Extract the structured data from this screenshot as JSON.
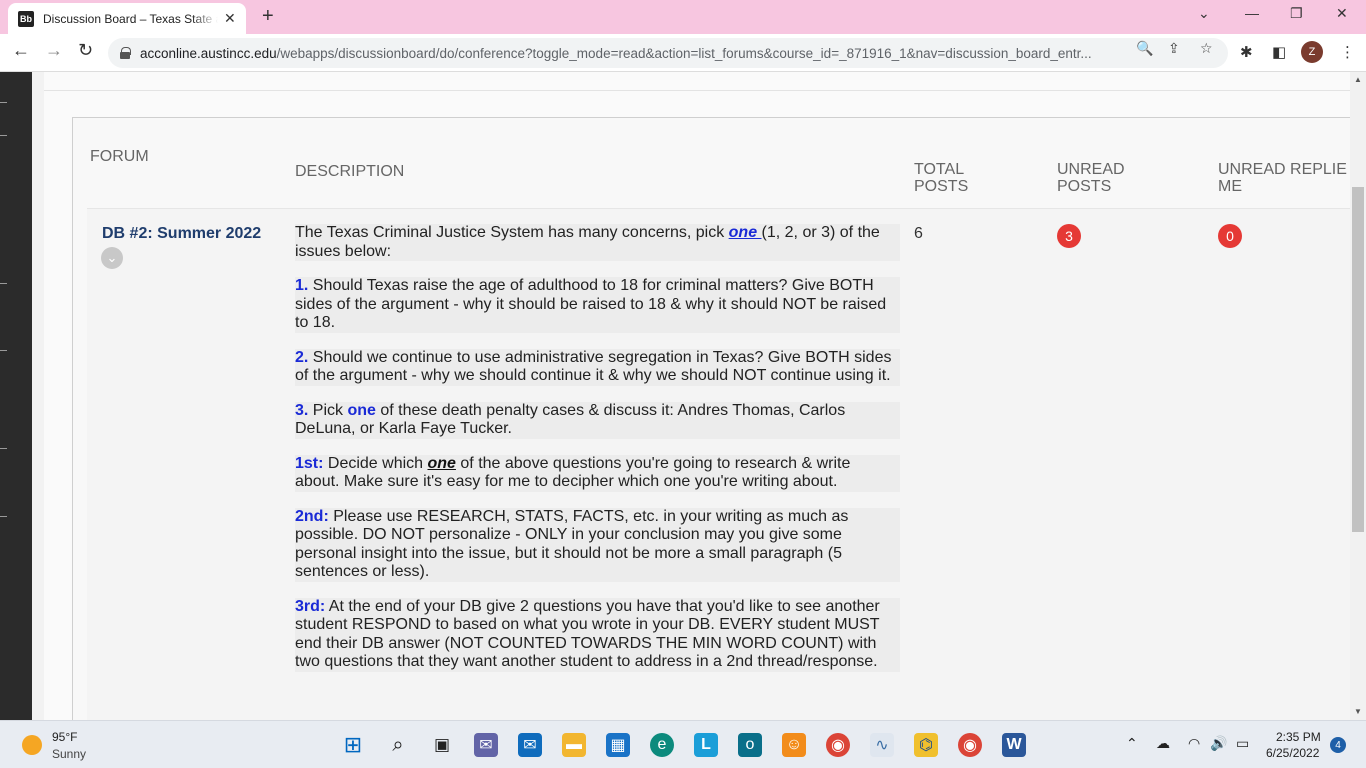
{
  "browser": {
    "tab_title": "Discussion Board – Texas State and Local Gov",
    "favicon_text": "Bb",
    "url_host": "acconline.austincc.edu",
    "url_path": "/webapps/discussionboard/do/conference?toggle_mode=read&action=list_forums&course_id=_871916_1&nav=discussion_board_entr...",
    "profile_initial": "Z"
  },
  "table": {
    "headers": {
      "forum": "FORUM",
      "description": "DESCRIPTION",
      "total_posts_1": "TOTAL",
      "total_posts_2": "POSTS",
      "unread_posts_1": "UNREAD",
      "unread_posts_2": "POSTS",
      "unread_replies_1": "UNREAD REPLIE",
      "unread_replies_2": "ME"
    },
    "row": {
      "forum_name": "DB #2: Summer 2022",
      "total_posts": "6",
      "unread_posts": "3",
      "unread_replies": "0",
      "intro_a": "The Texas Criminal Justice System has many concerns, pick ",
      "intro_one": "one ",
      "intro_b": "(1, 2, or 3) of the issues below:",
      "q1_num": "1.",
      "q1_text": " Should Texas raise the age of adulthood to 18 for criminal matters? Give BOTH sides of the argument - why it should be raised to 18 & why it should NOT be raised to 18.",
      "q2_num": "2.",
      "q2_text": " Should we continue to use administrative segregation in Texas? Give BOTH sides of the argument - why we should continue it & why we should NOT continue using it.",
      "q3_num": "3.",
      "q3_a": " Pick ",
      "q3_one": "one",
      "q3_b": " of these death penalty cases & discuss it: Andres Thomas, Carlos DeLuna, or Karla Faye Tucker.",
      "s1_label": "1st:",
      "s1_a": " Decide which ",
      "s1_one": "one",
      "s1_b": " of the above questions you're going to research & write about. Make sure it's easy for me to decipher which one you're writing about.",
      "s2_label": "2nd:",
      "s2_text": " Please use RESEARCH, STATS, FACTS, etc. in your writing as much as possible. DO NOT personalize - ONLY in your conclusion may you give some personal insight into the issue, but it should not be more a small paragraph (5 sentences or less).",
      "s3_label": "3rd:",
      "s3_text": "  At the end of your DB give 2 questions you have that you'd like to see another student RESPOND to based on what you wrote in your DB. EVERY student MUST end their DB answer (NOT COUNTED TOWARDS THE MIN WORD COUNT) with two questions that they want another student to address in a 2nd thread/response."
    }
  },
  "taskbar": {
    "temp": "95°F",
    "condition": "Sunny",
    "time": "2:35 PM",
    "date": "6/25/2022",
    "notifications": "4"
  },
  "colors": {
    "tabbar": "#f7c6e0",
    "link_blue": "#1f3d6d",
    "accent_blue": "#1a2ad6",
    "badge_red": "#e53935"
  }
}
